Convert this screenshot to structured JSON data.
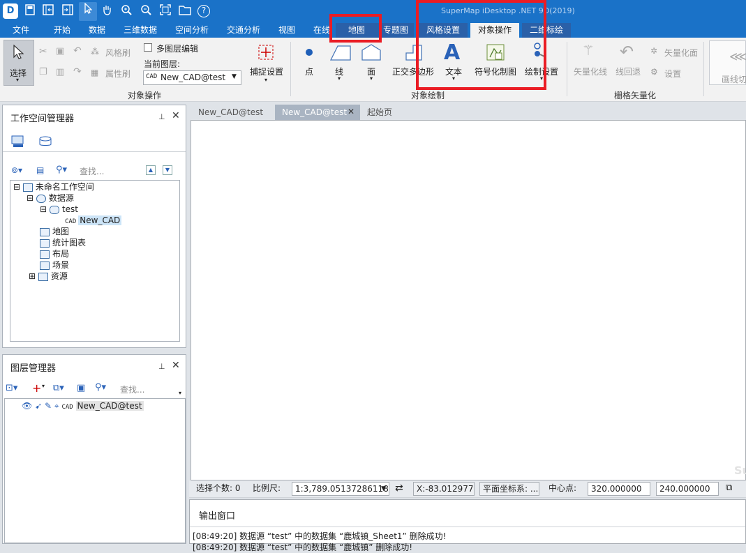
{
  "app_title": "SuperMap iDesktop .NET 9D(2019)",
  "qat": {
    "icons": [
      "app-logo-icon",
      "save-icon",
      "panel-icon",
      "panel2-icon",
      "select-arrow-icon",
      "pan-hand-icon",
      "zoom-in-icon",
      "zoom-out-icon",
      "full-extent-icon",
      "open-folder-icon",
      "help-icon"
    ],
    "help_glyph": "?"
  },
  "tabs": [
    "文件",
    "开始",
    "数据",
    "三维数据",
    "空间分析",
    "交通分析",
    "视图",
    "在线",
    "地图",
    "专题图",
    "风格设置",
    "对象操作",
    "二维标绘"
  ],
  "ribbon": {
    "select_label": "选择",
    "brush_label": "风格刷",
    "attr_brush_label": "属性刷",
    "multi_layer_label": "多图层编辑",
    "current_layer_label": "当前图层:",
    "current_layer_value": "New_CAD@test",
    "layer_prefix": "CAD",
    "snap_label": "捕捉设置",
    "group_obj_ops": "对象操作",
    "draw_items": [
      "点",
      "线",
      "面",
      "正交多边形",
      "文本",
      "符号化制图",
      "绘制设置"
    ],
    "group_obj_draw": "对象绘制",
    "text_glyph": "A",
    "vectorize_line": "矢量化线",
    "line_undo": "线回退",
    "vectorize_face": "矢量化面",
    "settings": "设置",
    "group_raster_vec": "栅格矢量化",
    "cutout": "画线切"
  },
  "workspace": {
    "title": "工作空间管理器",
    "search_placeholder": "查找...",
    "tree": {
      "root": "未命名工作空间",
      "datasources": "数据源",
      "db": "test",
      "dataset": "New_CAD",
      "map": "地图",
      "chart": "统计图表",
      "layout": "布局",
      "scene": "场景",
      "resources": "资源"
    },
    "expand_minus": "⊟",
    "expand_plus": "⊞"
  },
  "layers": {
    "title": "图层管理器",
    "search_placeholder": "查找...",
    "layer_name": "New_CAD@test"
  },
  "doc_tabs": [
    "New_CAD@test",
    "New_CAD@test",
    "起始页"
  ],
  "watermark": "Su",
  "status": {
    "select_count": "选择个数: 0",
    "scale_label": "比例尺:",
    "scale_value": "1:3,789.05137286118",
    "coord": "X:-83.012977,...",
    "crs": "平面坐标系: ...",
    "center_label": "中心点:",
    "center_x": "320.000000",
    "center_y": "240.000000"
  },
  "output": {
    "title": "输出窗口",
    "line1": "[08:49:20] 数据源 “test” 中的数据集 “鹿城镇_Sheet1” 删除成功!",
    "line2": "[08:49:20] 数据源 “test” 中的数据集 “鹿城镇” 删除成功!"
  },
  "colors": {
    "title_blue": "#1a72c8",
    "highlight_red": "#ea1c24",
    "active_tab": "#f2f2f2"
  }
}
